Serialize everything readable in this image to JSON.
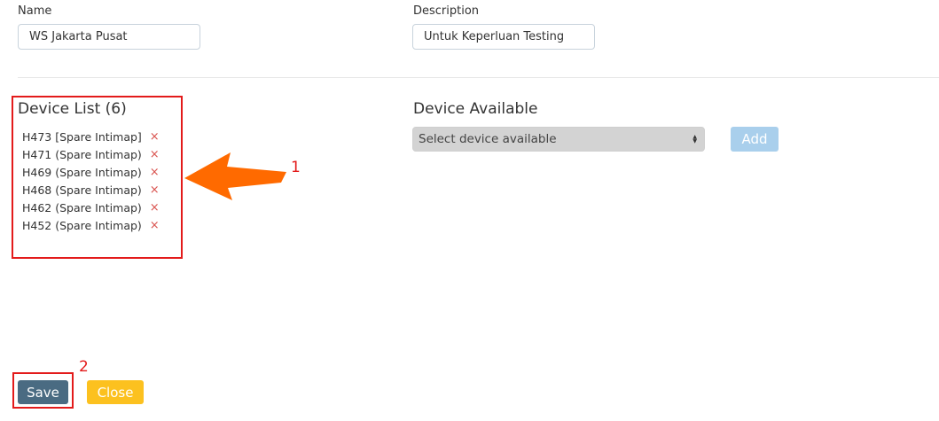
{
  "form": {
    "name_label": "Name",
    "name_value": "WS Jakarta Pusat",
    "description_label": "Description",
    "description_value": "Untuk Keperluan Testing"
  },
  "device_list": {
    "title": "Device List (6)",
    "remove_glyph": "×",
    "items": [
      {
        "label": "H473 [Spare Intimap]"
      },
      {
        "label": "H471 (Spare Intimap)"
      },
      {
        "label": "H469 (Spare Intimap)"
      },
      {
        "label": "H468 (Spare Intimap)"
      },
      {
        "label": "H462 (Spare Intimap)"
      },
      {
        "label": "H452 (Spare Intimap)"
      }
    ]
  },
  "device_available": {
    "title": "Device Available",
    "select_placeholder": "Select device available",
    "add_label": "Add"
  },
  "actions": {
    "save_label": "Save",
    "close_label": "Close"
  },
  "annotations": {
    "marker_1": "1",
    "marker_2": "2",
    "arrow_color": "#ff6a00",
    "box_color": "#e31b1b"
  },
  "colors": {
    "save_button": "#4a6b82",
    "close_button": "#fcc11f",
    "add_button": "#a9cfec",
    "remove_icon": "#d9534f"
  }
}
